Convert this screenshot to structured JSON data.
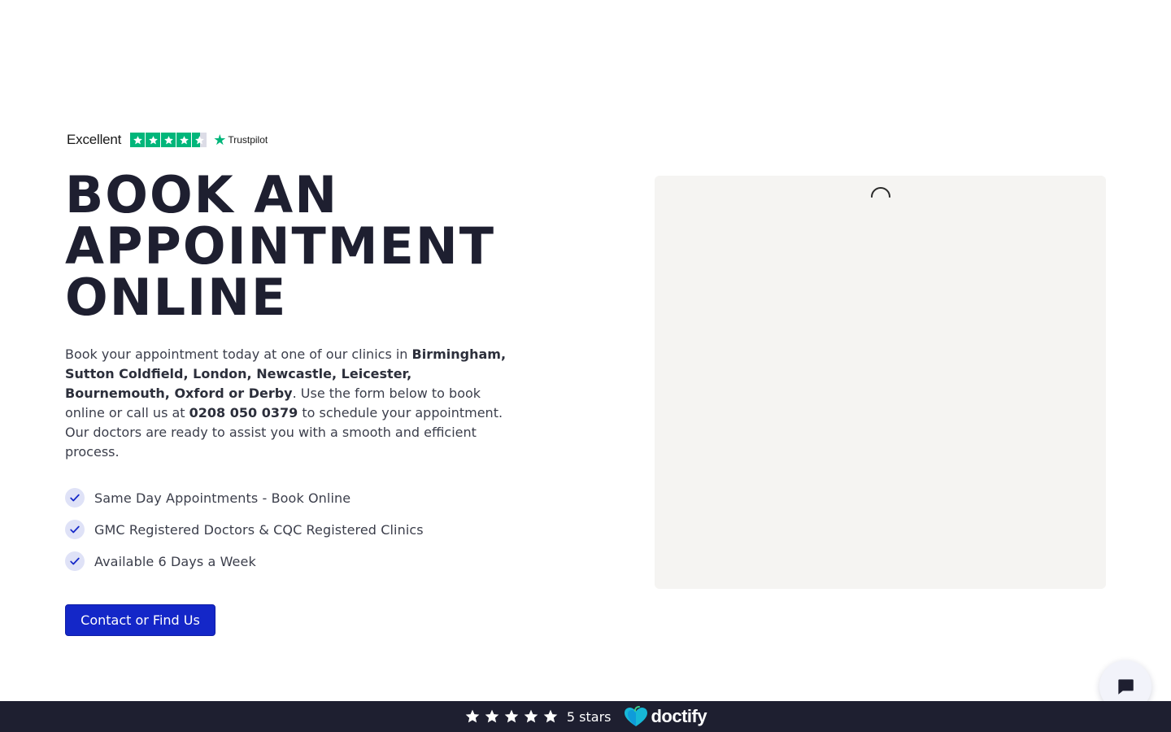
{
  "trustpilot": {
    "rating_word": "Excellent",
    "brand": "Trustpilot",
    "stars_filled": 4.5,
    "star_color": "#00b67a"
  },
  "hero": {
    "title_lines": [
      "BOOK AN",
      "APPOINTMENT",
      "ONLINE"
    ]
  },
  "intro": {
    "lead": "Book your appointment today at one of our clinics in ",
    "clinics": "Birmingham, Sutton Coldfield, London, Newcastle, Leicester, Bournemouth, Oxford or Derby",
    "mid": ". Use the form below to book online or call us at ",
    "phone": "0208 050 0379",
    "tail": " to schedule your appointment. Our doctors are ready to assist you with a smooth and efficient process."
  },
  "features": [
    {
      "label": "Same Day Appointments - Book Online",
      "icon": "check-icon"
    },
    {
      "label": "GMC Registered Doctors & CQC Registered Clinics",
      "icon": "check-icon"
    },
    {
      "label": "Available 6 Days a Week",
      "icon": "check-icon"
    }
  ],
  "cta": {
    "label": "Contact or Find Us"
  },
  "booking_widget": {
    "state": "loading",
    "icon": "loading-spinner-icon"
  },
  "chat": {
    "icon": "chat-bubble-icon"
  },
  "footer": {
    "stars": 5,
    "rating_text": "5 stars",
    "brand": "doctify"
  },
  "colors": {
    "primary_button": "#1427c8",
    "title": "#1e1f30",
    "footer_bg": "#1e1f30",
    "widget_bg": "#f5f4f2",
    "check_bg": "#dfe2f7"
  }
}
